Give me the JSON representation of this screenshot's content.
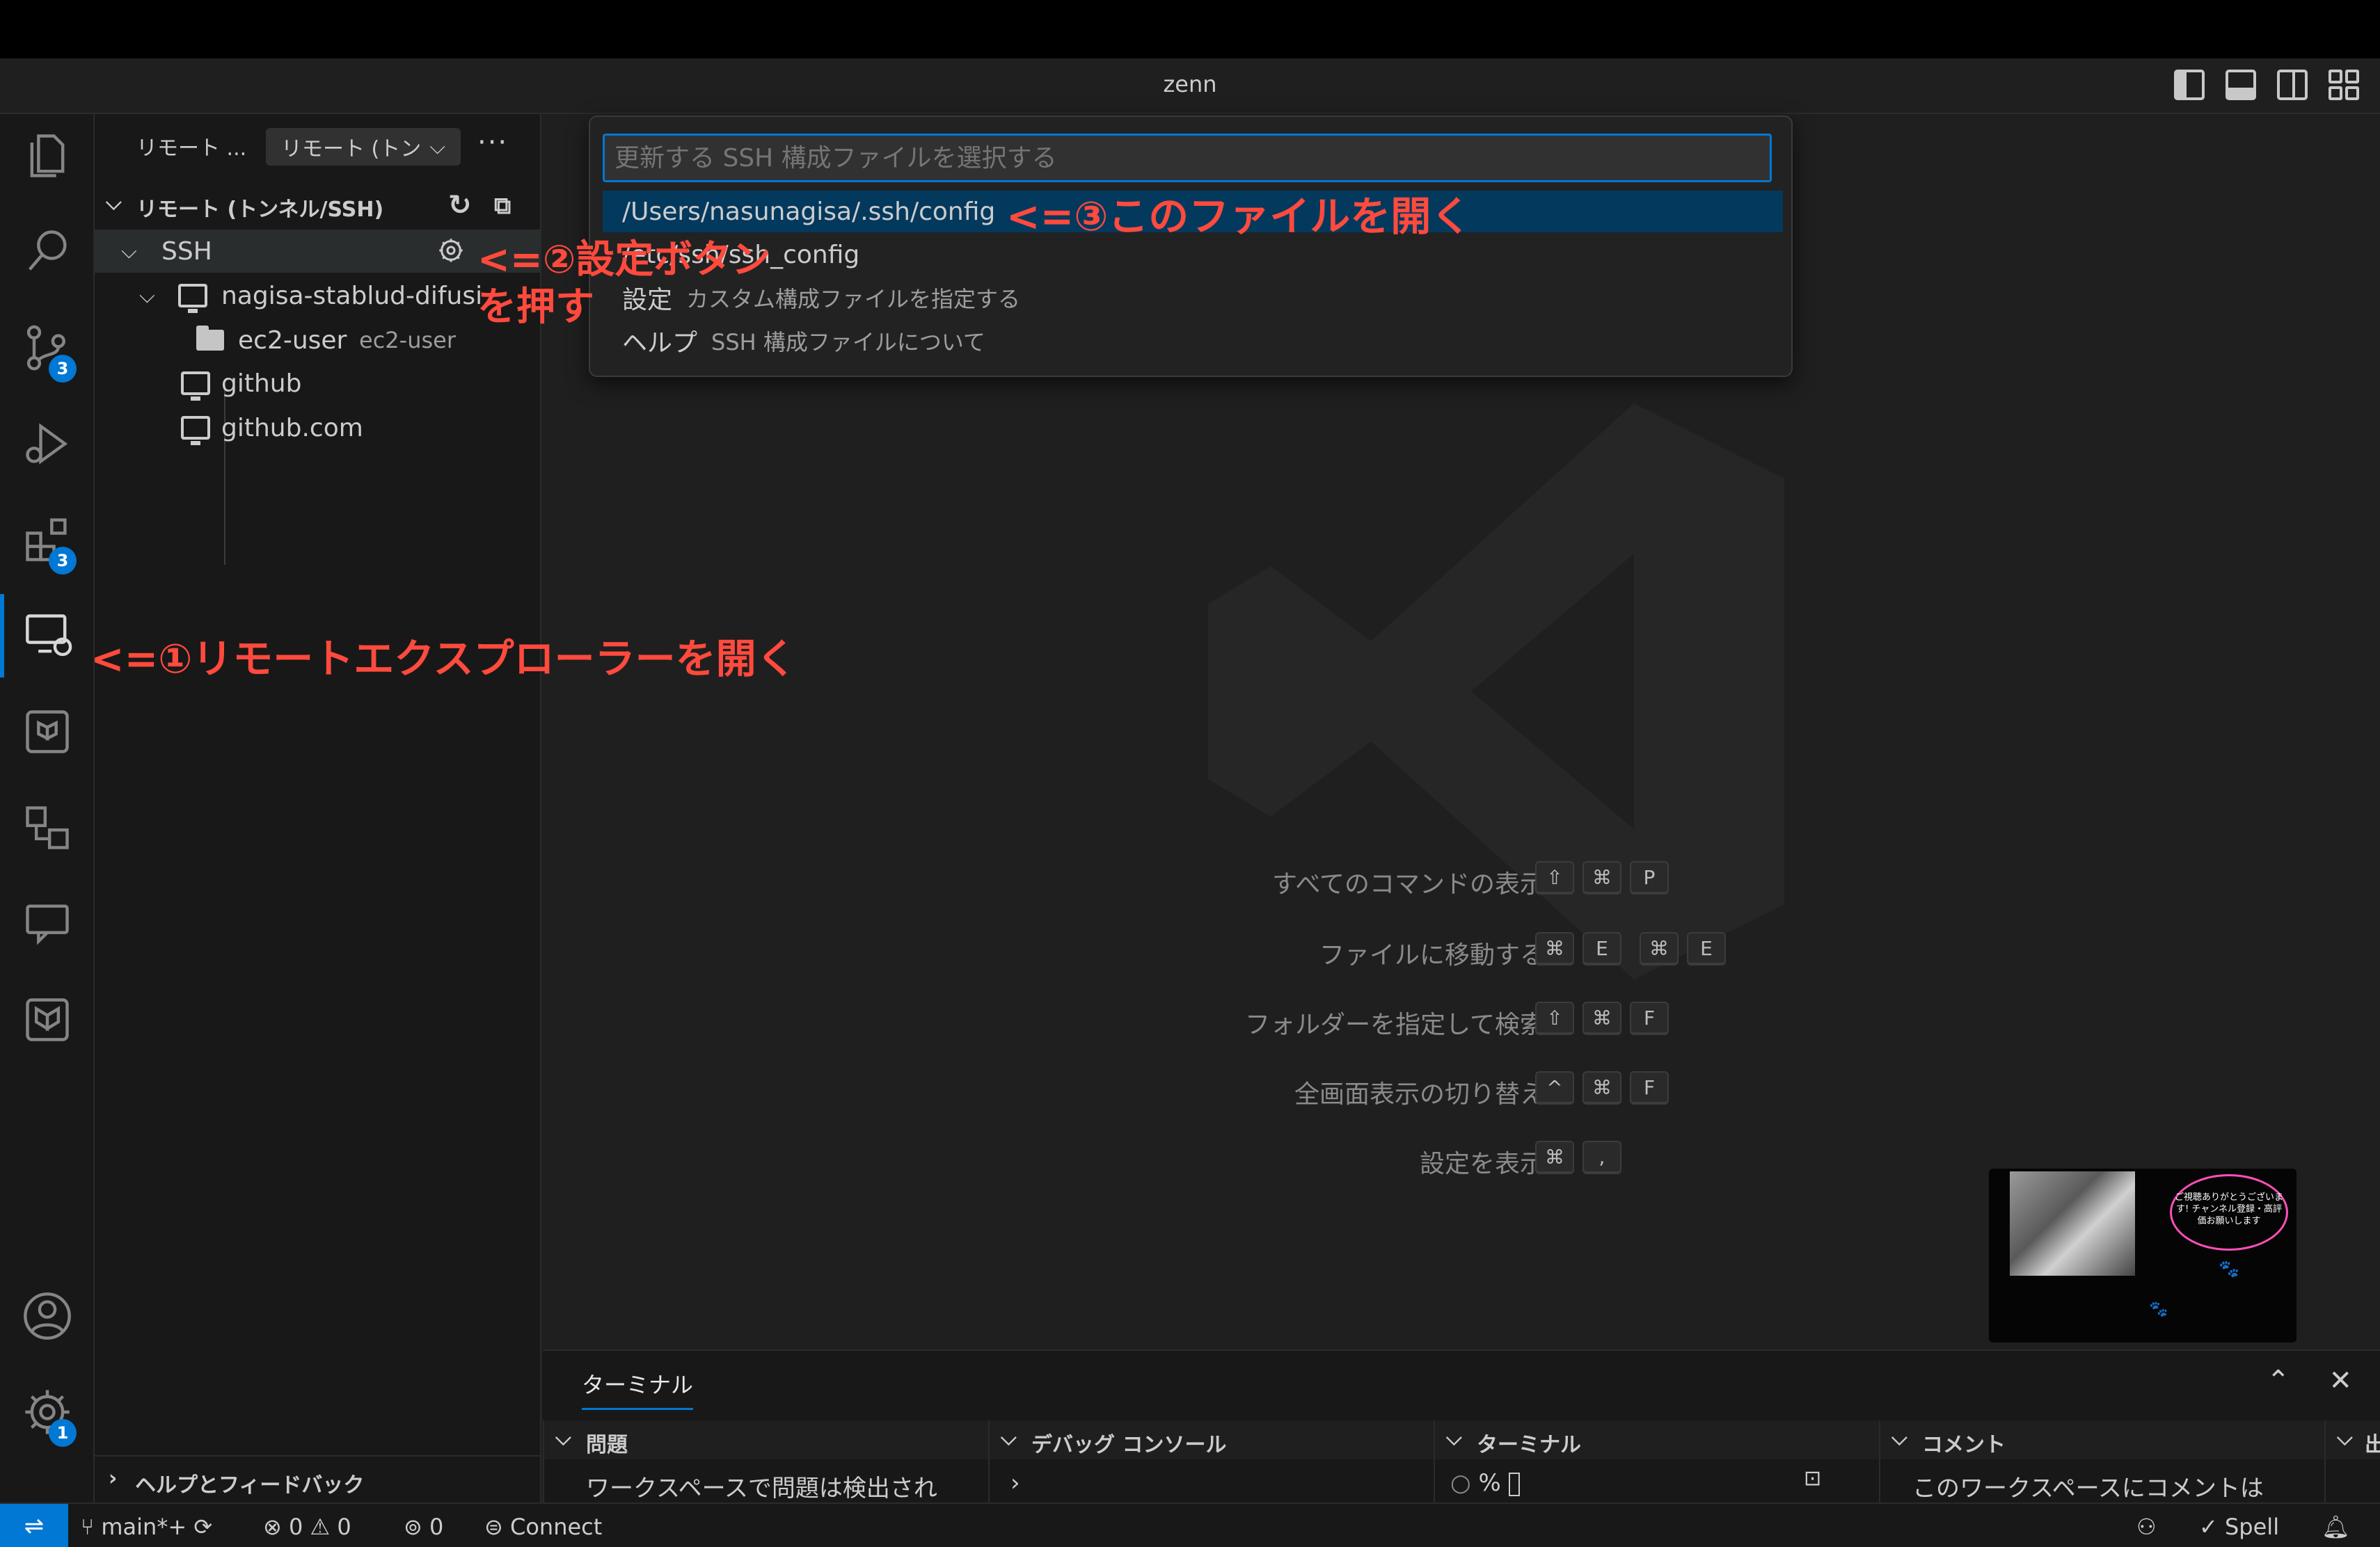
{
  "window": {
    "title": "zenn"
  },
  "sidebar": {
    "header": "リモート ...",
    "dropdown_value": "リモート (トン",
    "section_title": "リモート (トンネル/SSH)",
    "tree": [
      {
        "label": "SSH"
      },
      {
        "label": "nagisa-stablud-difusi"
      },
      {
        "label": "ec2-user",
        "desc": "ec2-user"
      },
      {
        "label": "github"
      },
      {
        "label": "github.com"
      }
    ],
    "help_section": "ヘルプとフィードバック"
  },
  "quickpick": {
    "placeholder": "更新する SSH 構成ファイルを選択する",
    "items": [
      {
        "label": "/Users/nasunagisa/.ssh/config"
      },
      {
        "label": "/etc/ssh/ssh_config"
      },
      {
        "label": "設定",
        "desc": "カスタム構成ファイルを指定する"
      },
      {
        "label": "ヘルプ",
        "desc": "SSH 構成ファイルについて"
      }
    ]
  },
  "shortcuts": [
    {
      "label": "すべてのコマンドの表示",
      "keys": [
        "⇧",
        "⌘",
        "P"
      ]
    },
    {
      "label": "ファイルに移動する",
      "keys": [
        "⌘",
        "E",
        "⌘",
        "E"
      ]
    },
    {
      "label": "フォルダーを指定して検索",
      "keys": [
        "⇧",
        "⌘",
        "F"
      ]
    },
    {
      "label": "全画面表示の切り替え",
      "keys": [
        "^",
        "⌘",
        "F"
      ]
    },
    {
      "label": "設定を表示",
      "keys": [
        "⌘",
        ","
      ]
    }
  ],
  "activity": {
    "source_control_badge": "3",
    "extensions_badge": "3",
    "settings_badge": "1"
  },
  "panel": {
    "tab": "ターミナル",
    "sections": [
      {
        "title": "問題",
        "body": "ワークスペースで問題は検出され"
      },
      {
        "title": "デバッグ コンソール",
        "body": ""
      },
      {
        "title": "ターミナル",
        "body": "%"
      },
      {
        "title": "コメント",
        "body": "このワークスペースにコメントは"
      },
      {
        "title": "出"
      }
    ]
  },
  "pip": {
    "bubble_text": "ご視聴ありがとうございます! チャンネル登録・高評価お願いします"
  },
  "statusbar": {
    "branch": "main*+",
    "errors": "0",
    "warnings": "0",
    "ports": "0",
    "connect": "Connect",
    "spell": "Spell"
  },
  "annotations": {
    "step1": "<=①リモートエクスプローラーを開く",
    "step2a": "<=②設定ボタン",
    "step2b": "を押す",
    "step3": "<=③このファイルを開く"
  },
  "colors": {
    "accent": "#0078d4",
    "annotation": "#ff4a3d",
    "selection": "#04395e"
  }
}
